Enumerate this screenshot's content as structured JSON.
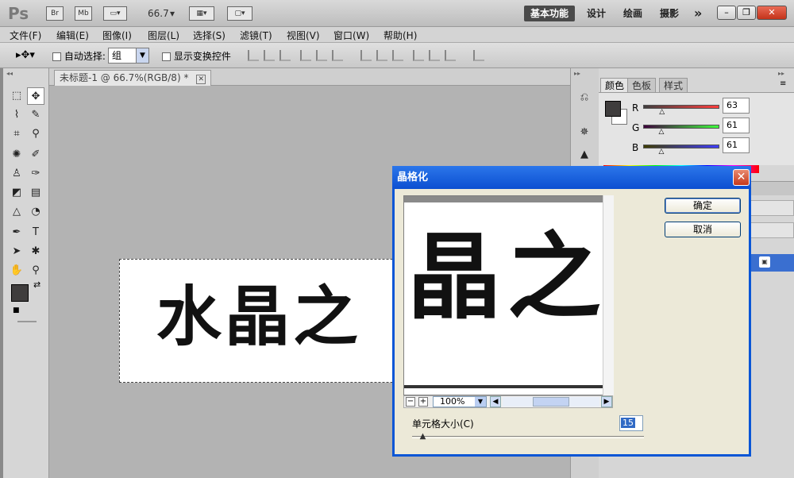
{
  "appbar": {
    "logo": "Ps",
    "icons": [
      "Br",
      "Mb"
    ],
    "zoom": "66.7",
    "workspaces": [
      {
        "label": "基本功能",
        "active": true
      },
      {
        "label": "设计",
        "active": false
      },
      {
        "label": "绘画",
        "active": false
      },
      {
        "label": "摄影",
        "active": false
      }
    ],
    "more": "»"
  },
  "menu": [
    "文件(F)",
    "编辑(E)",
    "图像(I)",
    "图层(L)",
    "选择(S)",
    "滤镜(T)",
    "视图(V)",
    "窗口(W)",
    "帮助(H)"
  ],
  "options": {
    "auto_select_label": "自动选择:",
    "auto_select_value": "组",
    "show_transform_label": "显示变换控件"
  },
  "document": {
    "tab_title": "未标题-1 @ 66.7%(RGB/8) *",
    "canvas_text": "水晶之"
  },
  "color_panel": {
    "tabs": [
      {
        "label": "颜色",
        "active": true
      },
      {
        "label": "色板",
        "active": false
      },
      {
        "label": "样式",
        "active": false
      }
    ],
    "channels": [
      {
        "name": "R",
        "value": "63",
        "level": 0.247
      },
      {
        "name": "G",
        "value": "61",
        "level": 0.239
      },
      {
        "name": "B",
        "value": "61",
        "level": 0.239
      }
    ],
    "fg_color": "#3f3d3d",
    "bg_color": "#ffffff"
  },
  "dialog": {
    "title": "晶格化",
    "ok_label": "确定",
    "cancel_label": "取消",
    "preview_text": "晶之",
    "zoom_value": "100%",
    "cell_size_label": "单元格大小(C)",
    "cell_size_value": "15",
    "cell_size_level": 0.05
  },
  "colors": {
    "dialog_title_bg": "#0c4fd1",
    "dialog_body": "#ece9d8",
    "active_workspace": "#4a4a4a"
  }
}
